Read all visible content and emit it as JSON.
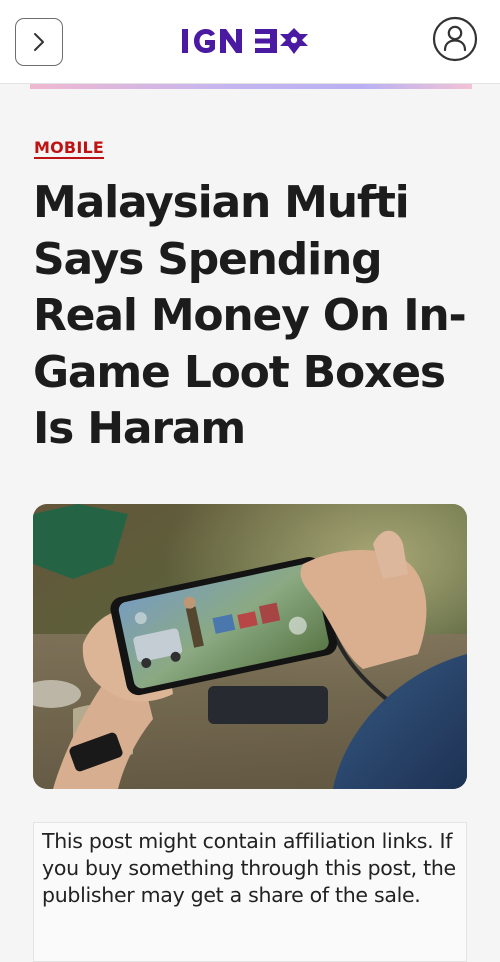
{
  "header": {
    "logo_text": "IGN 30",
    "menu_icon": "chevron-right-icon",
    "profile_icon": "user-profile-icon",
    "brand_color": "#4a1aa3"
  },
  "article": {
    "category": "MOBILE",
    "category_color": "#bf1313",
    "headline": "Malaysian Mufti Says Spending Real Money On In-Game Loot Boxes Is Haram",
    "hero_image": "hands-holding-smartphone-playing-mobile-game-photo",
    "disclaimer": "This post might contain affiliation links. If you buy something through this post, the publisher may get a share of the sale."
  }
}
